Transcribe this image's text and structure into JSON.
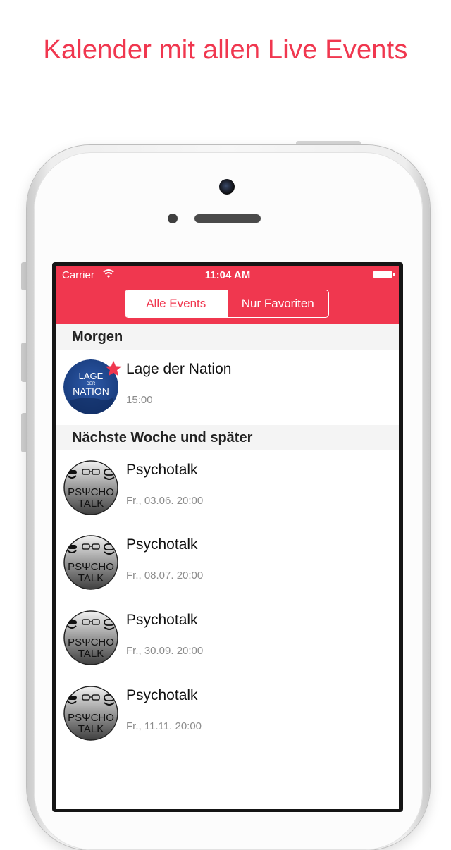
{
  "headline": "Kalender mit allen Live Events",
  "status_bar": {
    "carrier": "Carrier",
    "time": "11:04 AM"
  },
  "segments": [
    {
      "label": "Alle Events",
      "selected": true
    },
    {
      "label": "Nur Favoriten",
      "selected": false
    }
  ],
  "sections": [
    {
      "title": "Morgen",
      "events": [
        {
          "title": "Lage der Nation",
          "time": "15:00",
          "favorite": true,
          "logo": "Lage der Nation"
        }
      ]
    },
    {
      "title": "Nächste Woche und später",
      "events": [
        {
          "title": "Psychotalk",
          "time": "Fr., 03.06. 20:00",
          "favorite": false,
          "logo": "Psychotalk"
        },
        {
          "title": "Psychotalk",
          "time": "Fr., 08.07. 20:00",
          "favorite": false,
          "logo": "Psychotalk"
        },
        {
          "title": "Psychotalk",
          "time": "Fr., 30.09. 20:00",
          "favorite": false,
          "logo": "Psychotalk"
        },
        {
          "title": "Psychotalk",
          "time": "Fr., 11.11. 20:00",
          "favorite": false,
          "logo": "Psychotalk"
        }
      ]
    }
  ],
  "logo_text": {
    "lage": {
      "line1": "LAGE",
      "line2": "DER",
      "line3": "NATION"
    },
    "psycho": {
      "line1": "PSΨCHO",
      "line2": "TALK"
    }
  },
  "colors": {
    "accent": "#f0374f",
    "section_bg": "#f4f4f4",
    "muted_text": "#8c8c8c"
  },
  "icons": [
    "wifi-icon",
    "battery-icon",
    "star-icon"
  ]
}
